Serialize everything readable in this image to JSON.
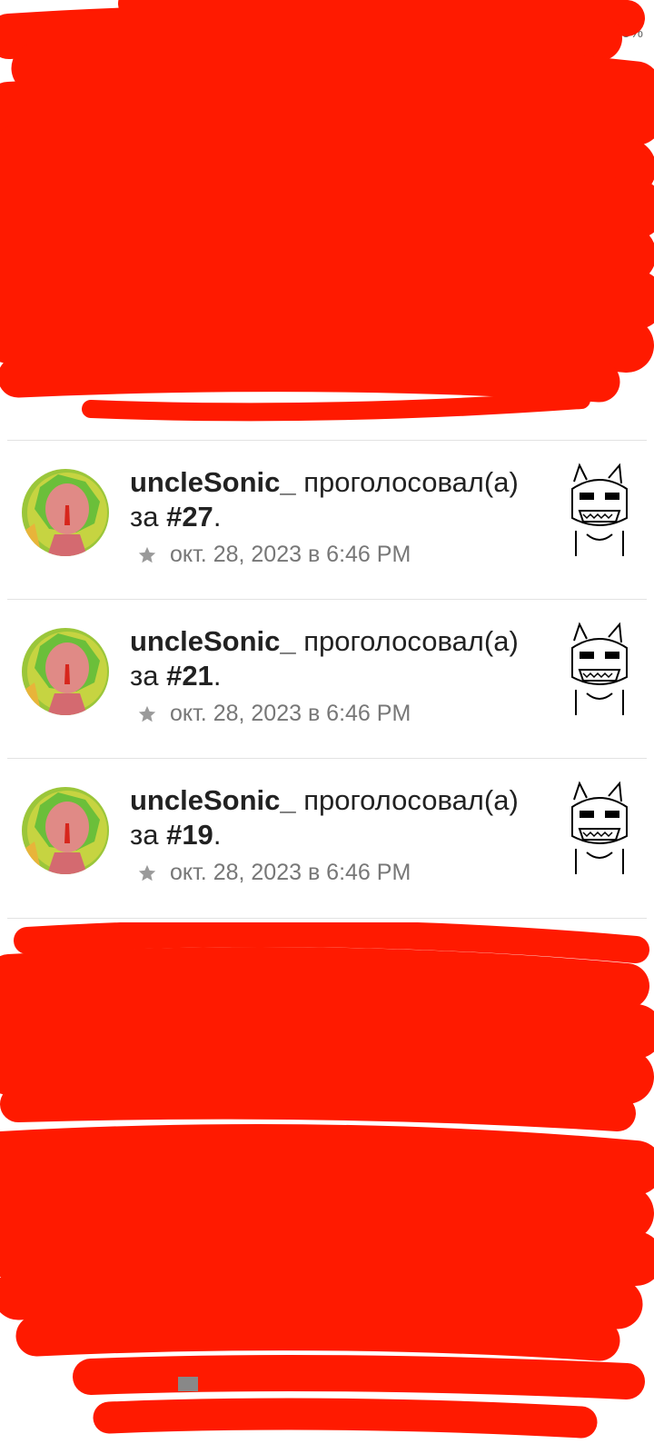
{
  "status": {
    "battery": "15%"
  },
  "notifications": [
    {
      "user": "uncleSonic_",
      "action": " проголосовал(а) за ",
      "number": "#27",
      "end": ".",
      "time": "окт. 28, 2023 в 6:46 PM"
    },
    {
      "user": "uncleSonic_",
      "action": " проголосовал(а) за ",
      "number": "#21",
      "end": ".",
      "time": "окт. 28, 2023 в 6:46 PM"
    },
    {
      "user": "uncleSonic_",
      "action": " проголосовал(а) за ",
      "number": "#19",
      "end": ".",
      "time": "окт. 28, 2023 в 6:46 PM"
    }
  ],
  "colors": {
    "redaction": "#ff1a00",
    "divider": "#e3e3e3",
    "meta": "#777777"
  },
  "icons": {
    "time": "star-icon"
  }
}
